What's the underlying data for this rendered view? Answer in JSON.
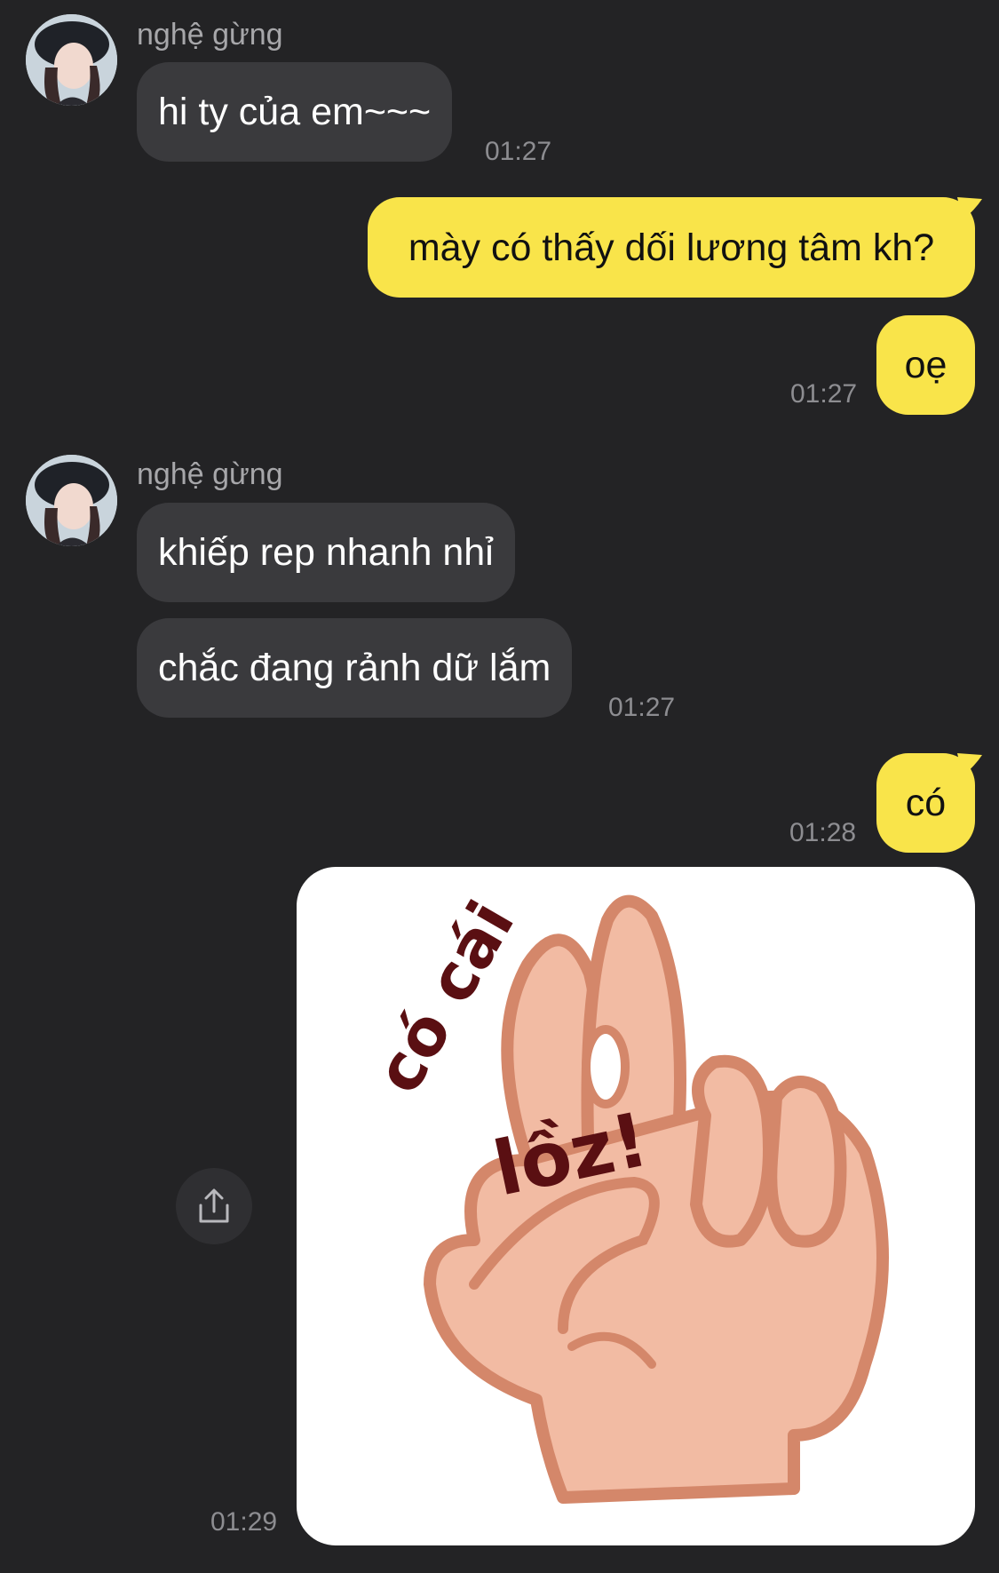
{
  "messages": {
    "group1": {
      "sender": "nghệ gừng",
      "texts": [
        "hi ty của em~~~"
      ],
      "time": "01:27"
    },
    "out1": {
      "texts": [
        "mày có thấy dối lương tâm kh?",
        "oẹ"
      ],
      "time": "01:27"
    },
    "group2": {
      "sender": "nghệ gừng",
      "texts": [
        "khiếp rep nhanh nhỉ",
        "chắc đang rảnh dữ lắm"
      ],
      "time": "01:27"
    },
    "out2": {
      "texts": [
        "có"
      ],
      "time": "01:28"
    },
    "sticker": {
      "caption_top": "có cái",
      "caption_bottom": "lồz!",
      "time": "01:29"
    }
  },
  "icons": {
    "share": "share-icon",
    "avatar": "avatar"
  },
  "colors": {
    "background": "#232325",
    "incoming_bubble": "#3a3a3d",
    "outgoing_bubble": "#f9e44a",
    "timestamp": "#8d8d91",
    "sender_name": "#a7a7aa"
  }
}
